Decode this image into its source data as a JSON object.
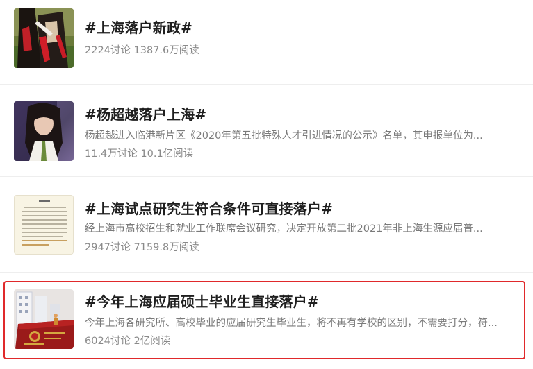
{
  "topics": [
    {
      "title": "#上海落户新政#",
      "description": "",
      "meta": "2224讨论 1387.6万阅读",
      "thumbnail": "graduation-photo"
    },
    {
      "title": "#杨超越落户上海#",
      "description": "杨超越进入临港新片区《2020年第五批特殊人才引进情况的公示》名单，其申报单位为...",
      "meta": "11.4万讨论 10.1亿阅读",
      "thumbnail": "portrait-photo"
    },
    {
      "title": "#上海试点研究生符合条件可直接落户#",
      "description": "经上海市高校招生和就业工作联席会议研究，决定开放第二批2021年非上海生源应届普...",
      "meta": "2947讨论 7159.8万阅读",
      "thumbnail": "notice-document"
    },
    {
      "title": "#今年上海应届硕士毕业生直接落户#",
      "description": "今年上海各研究所、高校毕业的应届研究生毕业生，将不再有学校的区别，不需要打分，符...",
      "meta": "6024讨论 2亿阅读",
      "thumbnail": "household-register-book"
    }
  ],
  "colors": {
    "title": "#1f1f1f",
    "description": "#7a7a7a",
    "meta": "#8a8a8a",
    "highlight": "#e0292b"
  }
}
